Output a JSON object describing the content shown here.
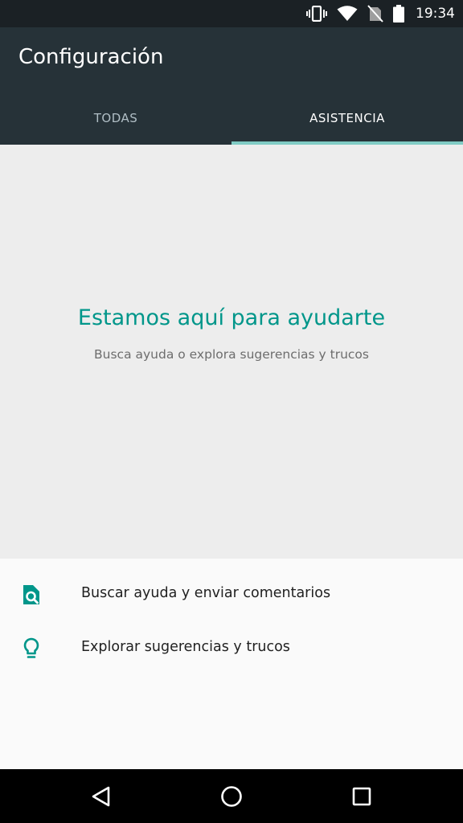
{
  "status_bar": {
    "time": "19:34",
    "icons": [
      "vibrate-icon",
      "wifi-icon",
      "no-sim-icon",
      "battery-icon"
    ]
  },
  "app_bar": {
    "title": "Configuración",
    "tabs": [
      {
        "label": "TODAS",
        "selected": false
      },
      {
        "label": "ASISTENCIA",
        "selected": true
      }
    ]
  },
  "hero": {
    "title": "Estamos aquí para ayudarte",
    "subtitle": "Busca ayuda o explora sugerencias y trucos"
  },
  "list": {
    "items": [
      {
        "label": "Buscar ayuda y enviar comentarios",
        "icon": "help-search-icon"
      },
      {
        "label": "Explorar sugerencias y trucos",
        "icon": "lightbulb-icon"
      }
    ]
  },
  "nav_bar": {
    "buttons": [
      "back-icon",
      "home-icon",
      "recents-icon"
    ]
  },
  "colors": {
    "accent": "#00968a",
    "app_bar": "#263238",
    "status_bar": "#1b2125",
    "tab_indicator": "#80cbc4"
  }
}
